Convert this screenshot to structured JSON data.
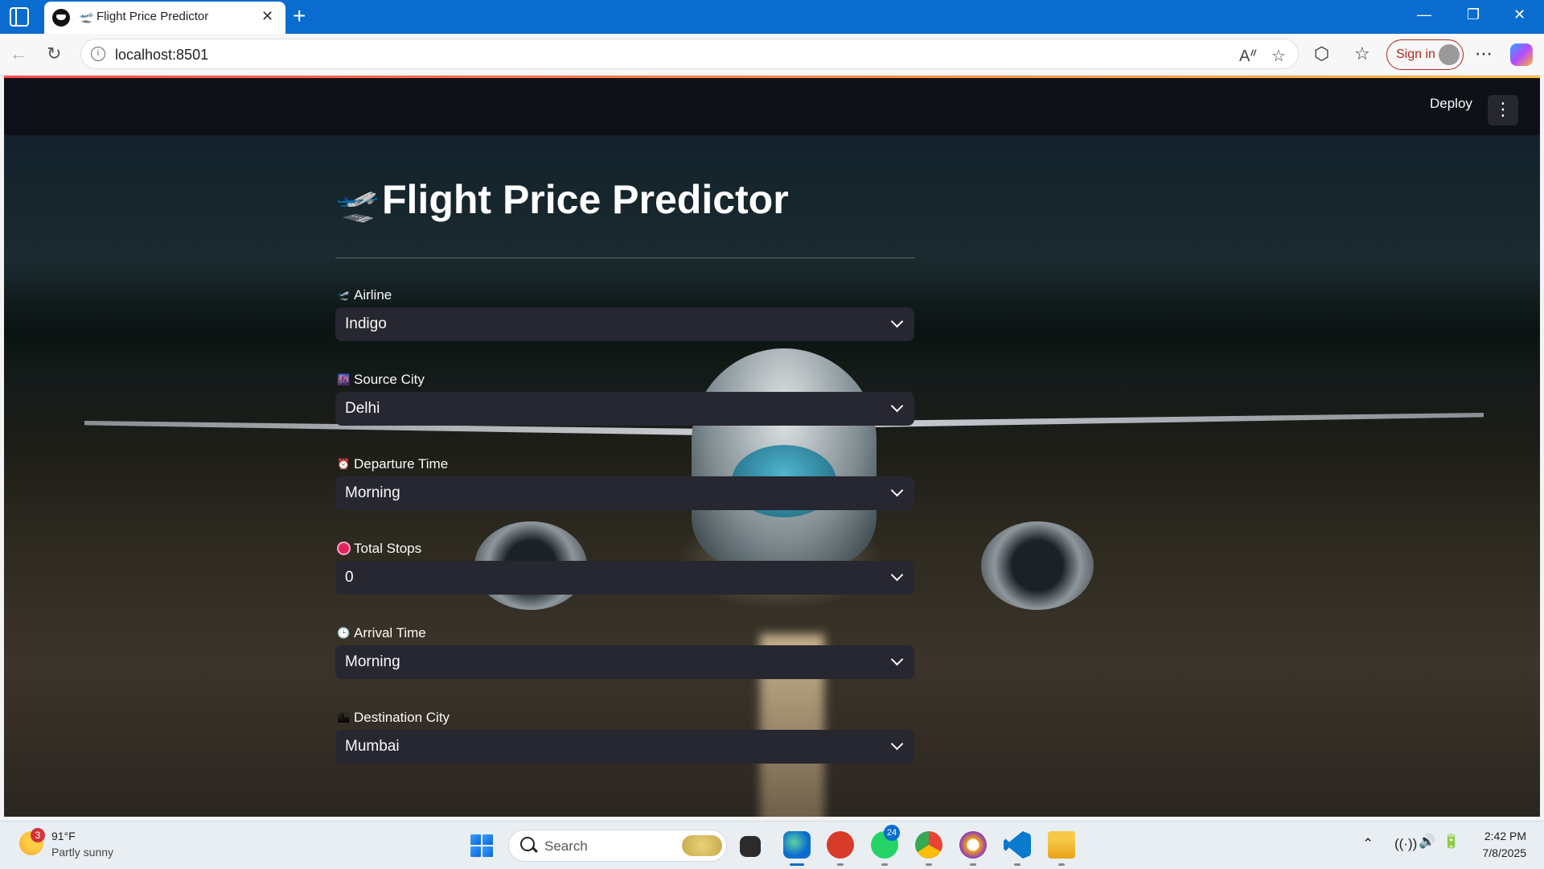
{
  "browser": {
    "tab_title": "Flight Price Predictor",
    "tab_plane_glyph": "🛫",
    "tab_close_glyph": "✕",
    "new_tab_glyph": "+",
    "url": "localhost:8501",
    "sign_in_label": "Sign in",
    "window_controls": {
      "minimize": "—",
      "restore": "❐",
      "close": "✕"
    }
  },
  "app": {
    "deploy_label": "Deploy",
    "menu_glyph": "⋮",
    "title_icon": "🛫",
    "title": "Flight Price Predictor",
    "fields": [
      {
        "icon": "airplane-icon",
        "glyph": "🛫",
        "label": "Airline",
        "value": "Indigo",
        "icon_color": "#4a90d9"
      },
      {
        "icon": "city-icon",
        "glyph": "🌆",
        "label": "Source City",
        "value": "Delhi",
        "icon_color": "#6a3fa0"
      },
      {
        "icon": "alarm-clock-icon",
        "glyph": "⏰",
        "label": "Departure Time",
        "value": "Morning",
        "icon_color": "#e0413e"
      },
      {
        "icon": "red-circle-icon",
        "glyph": "",
        "label": "Total Stops",
        "value": "0",
        "icon_color": "#e0245e"
      },
      {
        "icon": "clock-icon",
        "glyph": "🕒",
        "label": "Arrival Time",
        "value": "Morning",
        "icon_color": "#9aa0a6"
      },
      {
        "icon": "city-skyline-icon",
        "glyph": "🏙",
        "label": "Destination City",
        "value": "Mumbai",
        "icon_color": "#d0d4d8"
      }
    ]
  },
  "taskbar": {
    "weather_temp": "91°F",
    "weather_desc": "Partly sunny",
    "weather_badge": "3",
    "search_label": "Search",
    "whatsapp_badge": "24",
    "time": "2:42 PM",
    "date": "7/8/2025"
  },
  "colors": {
    "browser_accent": "#0a6ccf",
    "app_header_bg": "#0e1117",
    "select_bg": "#262730",
    "sign_in": "#b3261e"
  }
}
